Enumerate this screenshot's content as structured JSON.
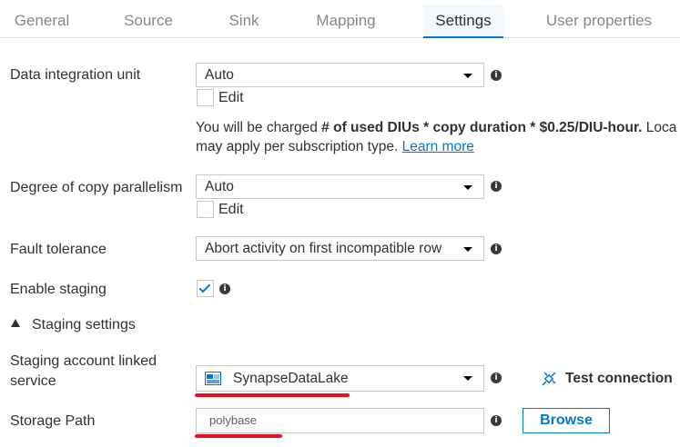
{
  "tabs": [
    {
      "label": "General"
    },
    {
      "label": "Source"
    },
    {
      "label": "Sink"
    },
    {
      "label": "Mapping"
    },
    {
      "label": "Settings"
    },
    {
      "label": "User properties"
    }
  ],
  "active_tab": "Settings",
  "diu": {
    "label": "Data integration unit",
    "value": "Auto",
    "edit_label": "Edit",
    "edit_checked": false
  },
  "note": {
    "prefix": "You will be charged ",
    "bold": "# of used DIUs * copy duration * $0.25/DIU-hour.",
    "suffix": " Loca",
    "line2": "may apply per subscription type. ",
    "link": "Learn more"
  },
  "parallelism": {
    "label": "Degree of copy parallelism",
    "value": "Auto",
    "edit_label": "Edit",
    "edit_checked": false
  },
  "fault_tolerance": {
    "label": "Fault tolerance",
    "value": "Abort activity on first incompatible row"
  },
  "staging": {
    "label": "Enable staging",
    "checked": true
  },
  "staging_settings": {
    "label": "Staging settings",
    "expanded": true
  },
  "linked_service": {
    "label_line1": "Staging account linked",
    "label_line2": "service",
    "value": "SynapseDataLake",
    "icon": "storage-account-icon"
  },
  "test_connection": {
    "label": "Test connection",
    "icon": "plug-icon"
  },
  "storage_path": {
    "label": "Storage Path",
    "value": "polybase"
  },
  "browse": {
    "label": "Browse"
  },
  "colors": {
    "accent": "#0078d4",
    "highlight": "#e81123"
  }
}
